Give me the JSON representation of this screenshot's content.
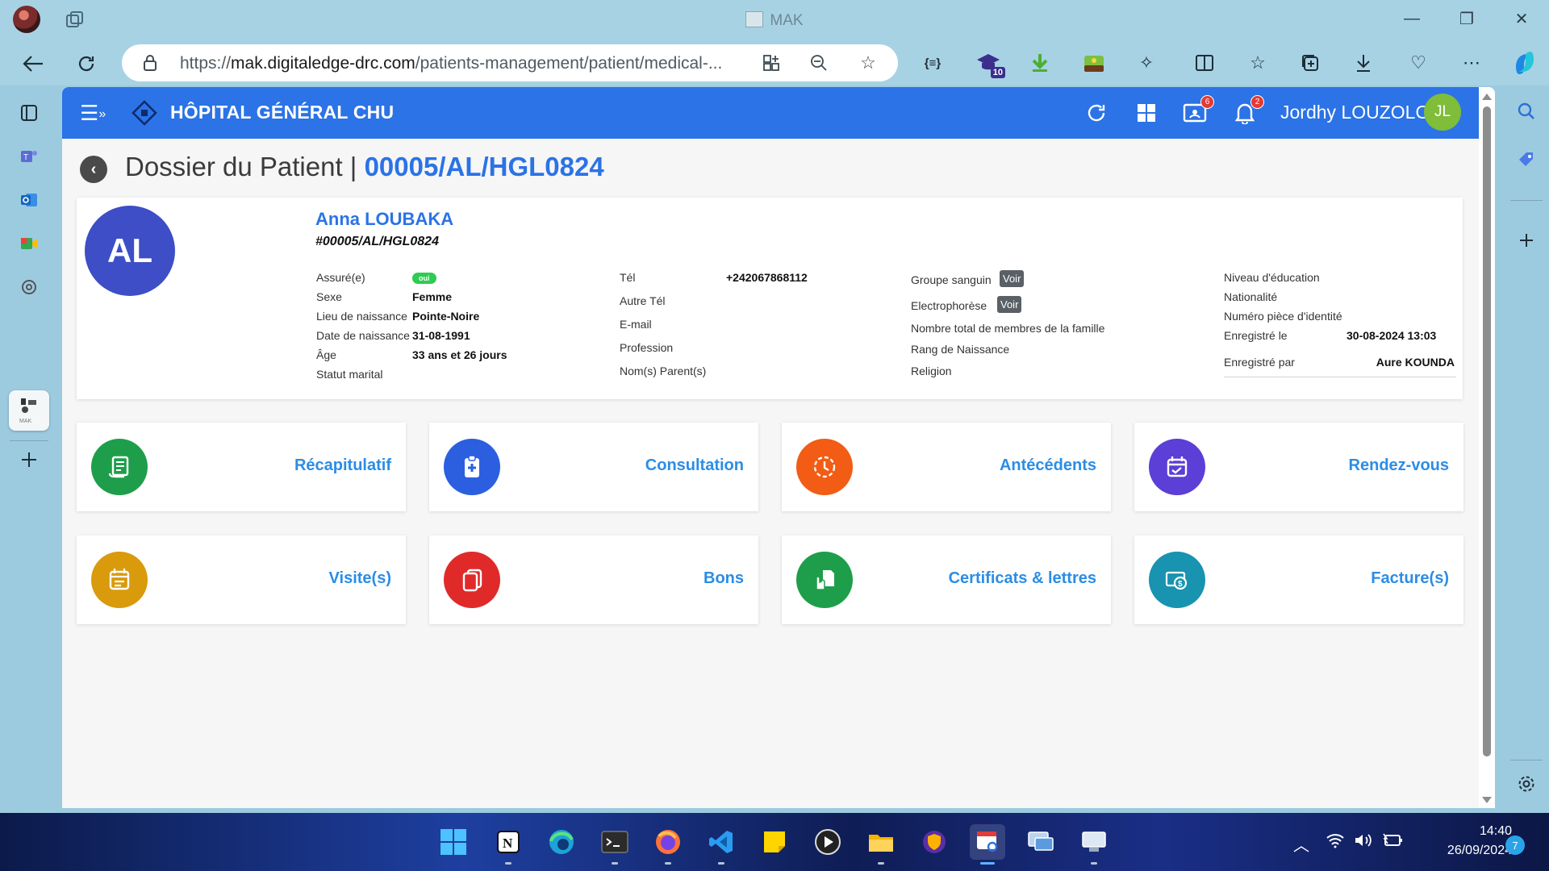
{
  "browser": {
    "window_title": "MAK",
    "url_prefix": "https://",
    "url_domain": "mak.digitaledge-drc.com",
    "url_path": "/patients-management/patient/medical-...",
    "extension_badge": "10"
  },
  "app": {
    "hospital_name": "HÔPITAL GÉNÉRAL CHU",
    "user_name": "Jordhy LOUZOLO",
    "user_initials": "JL",
    "consult_badge": "6",
    "notif_badge": "2",
    "accent": "#2b73e6"
  },
  "page": {
    "title_prefix": "Dossier du Patient | ",
    "record_number": "00005/AL/HGL0824"
  },
  "patient": {
    "initials": "AL",
    "name": "Anna LOUBAKA",
    "id": "#00005/AL/HGL0824",
    "col1": {
      "insured_label": "Assuré(e)",
      "insured_value": "oui",
      "sex_label": "Sexe",
      "sex_value": "Femme",
      "birthplace_label": "Lieu de naissance",
      "birthplace_value": "Pointe-Noire",
      "birthdate_label": "Date de naissance",
      "birthdate_value": "31-08-1991",
      "age_label": "Âge",
      "age_value": "33 ans et 26 jours",
      "marital_label": "Statut marital"
    },
    "col2": {
      "tel_label": "Tél",
      "tel_value": "+242067868112",
      "other_tel_label": "Autre Tél",
      "email_label": "E-mail",
      "profession_label": "Profession",
      "parents_label": "Nom(s) Parent(s)"
    },
    "col3": {
      "blood_label": "Groupe sanguin",
      "electro_label": "Electrophorèse",
      "voir_label": "Voir",
      "family_label": "Nombre total de membres de la famille",
      "birth_rank_label": "Rang de Naissance",
      "religion_label": "Religion"
    },
    "col4": {
      "education_label": "Niveau d'éducation",
      "nationality_label": "Nationalité",
      "id_doc_label": "Numéro pièce d'identité",
      "registered_label": "Enregistré le",
      "registered_value": "30-08-2024 13:03",
      "registered_by_label": "Enregistré par",
      "registered_by_value": "Aure KOUNDA"
    }
  },
  "tiles": [
    {
      "label": "Récapitulatif",
      "color": "#1e9e4a",
      "icon": "receipt-icon"
    },
    {
      "label": "Consultation",
      "color": "#2b5fe0",
      "icon": "clipboard-plus-icon"
    },
    {
      "label": "Antécédents",
      "color": "#f25c14",
      "icon": "history-icon"
    },
    {
      "label": "Rendez-vous",
      "color": "#5b3fd6",
      "icon": "calendar-check-icon"
    },
    {
      "label": "Visite(s)",
      "color": "#d99a0c",
      "icon": "calendar-list-icon"
    },
    {
      "label": "Bons",
      "color": "#e02a2a",
      "icon": "copy-icon"
    },
    {
      "label": "Certificats & lettres",
      "color": "#1e9e4a",
      "icon": "document-hand-icon"
    },
    {
      "label": "Facture(s)",
      "color": "#1893b0",
      "icon": "money-icon"
    }
  ],
  "taskbar": {
    "time": "14:40",
    "date": "26/09/2024",
    "notifications": "7"
  }
}
